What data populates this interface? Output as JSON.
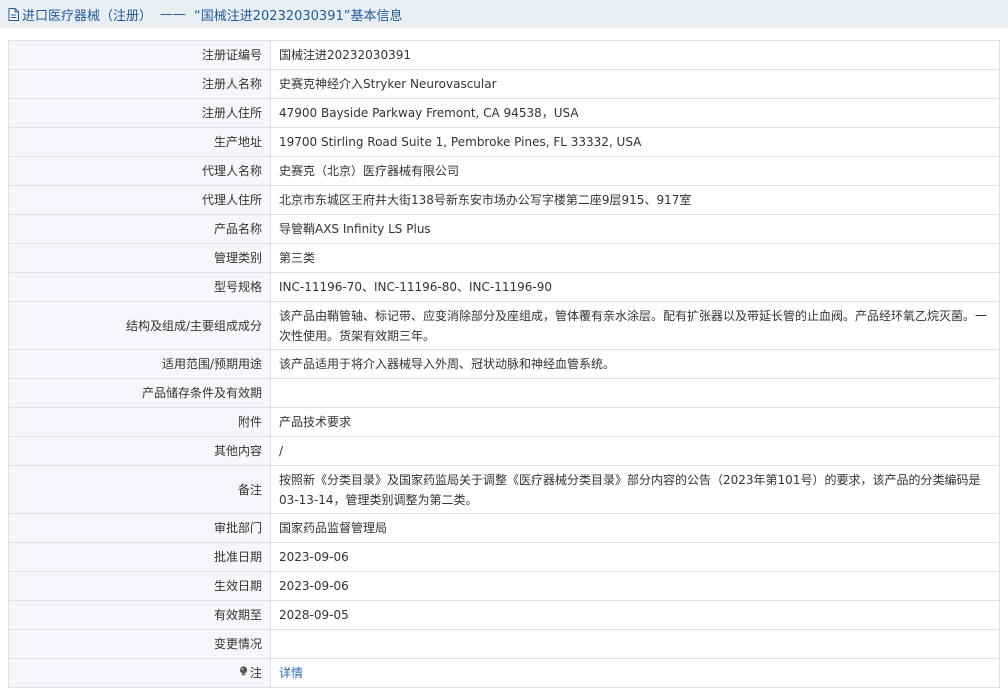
{
  "header": {
    "prefix": "进口医疗器械（注册）",
    "separator": "——",
    "title": "“国械注进20232030391”基本信息"
  },
  "rows": [
    {
      "label": "注册证编号",
      "value": "国械注进20232030391"
    },
    {
      "label": "注册人名称",
      "value": "史赛克神经介入Stryker Neurovascular"
    },
    {
      "label": "注册人住所",
      "value": "47900 Bayside Parkway Fremont, CA 94538，USA"
    },
    {
      "label": "生产地址",
      "value": "19700 Stirling Road Suite 1, Pembroke Pines, FL 33332, USA"
    },
    {
      "label": "代理人名称",
      "value": "史赛克（北京）医疗器械有限公司"
    },
    {
      "label": "代理人住所",
      "value": "北京市东城区王府井大街138号新东安市场办公写字楼第二座9层915、917室"
    },
    {
      "label": "产品名称",
      "value": "导管鞘AXS Infinity LS Plus"
    },
    {
      "label": "管理类别",
      "value": "第三类"
    },
    {
      "label": "型号规格",
      "value": "INC-11196-70、INC-11196-80、INC-11196-90"
    },
    {
      "label": "结构及组成/主要组成成分",
      "value": "该产品由鞘管轴、标记带、应变消除部分及座组成，管体覆有亲水涂层。配有扩张器以及带延长管的止血阀。产品经环氧乙烷灭菌。一次性使用。货架有效期三年。"
    },
    {
      "label": "适用范围/预期用途",
      "value": "该产品适用于将介入器械导入外周、冠状动脉和神经血管系统。"
    },
    {
      "label": "产品储存条件及有效期",
      "value": ""
    },
    {
      "label": "附件",
      "value": "产品技术要求"
    },
    {
      "label": "其他内容",
      "value": "/"
    },
    {
      "label": "备注",
      "value": "按照新《分类目录》及国家药监局关于调整《医疗器械分类目录》部分内容的公告（2023年第101号）的要求，该产品的分类编码是03-13-14，管理类别调整为第二类。"
    },
    {
      "label": "审批部门",
      "value": "国家药品监督管理局"
    },
    {
      "label": "批准日期",
      "value": "2023-09-06"
    },
    {
      "label": "生效日期",
      "value": "2023-09-06"
    },
    {
      "label": "有效期至",
      "value": "2028-09-05"
    },
    {
      "label": "变更情况",
      "value": ""
    }
  ],
  "note": {
    "label": "注",
    "link_text": "详情",
    "icon": "lightbulb-icon"
  },
  "colors": {
    "header_bg": "#e9eef3",
    "header_text": "#1f5a9c",
    "label_bg": "#f5f7fa",
    "border": "#dde3ea",
    "link": "#2a6db5"
  }
}
